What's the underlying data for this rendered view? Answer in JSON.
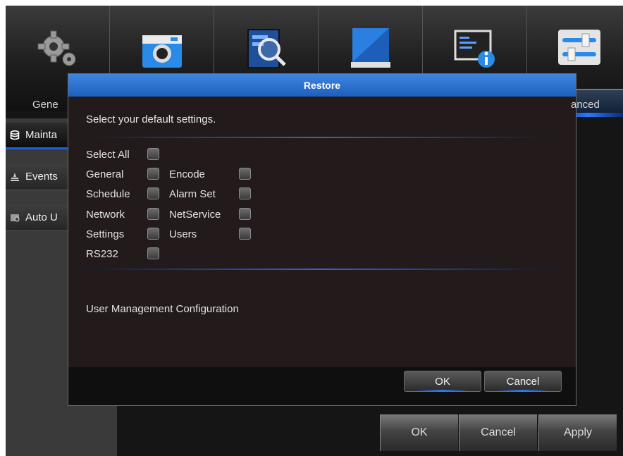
{
  "topbar": {
    "items": [
      {
        "label": "Gene",
        "icon": "gear-icon"
      },
      {
        "label": "",
        "icon": "camera-icon"
      },
      {
        "label": "",
        "icon": "search-icon"
      },
      {
        "label": "",
        "icon": "storage-icon"
      },
      {
        "label": "",
        "icon": "info-icon"
      },
      {
        "label": "anced",
        "icon": "sliders-icon"
      }
    ]
  },
  "sidebar": {
    "items": [
      {
        "label": "Mainta",
        "icon": "database-icon",
        "active": true
      },
      {
        "label": "Events",
        "icon": "events-icon",
        "active": false
      },
      {
        "label": "Auto U",
        "icon": "auto-upgrade-icon",
        "active": false
      }
    ]
  },
  "main_buttons": {
    "ok": "OK",
    "cancel": "Cancel",
    "apply": "Apply"
  },
  "dialog": {
    "title": "Restore",
    "prompt": "Select your default settings.",
    "select_all": "Select All",
    "options": [
      {
        "label": "General",
        "checked": false
      },
      {
        "label": "Encode",
        "checked": false
      },
      {
        "label": "Schedule",
        "checked": false
      },
      {
        "label": "Alarm Set",
        "checked": false
      },
      {
        "label": "Network",
        "checked": false
      },
      {
        "label": "NetService",
        "checked": false
      },
      {
        "label": "Settings",
        "checked": false
      },
      {
        "label": "Users",
        "checked": false
      },
      {
        "label": "RS232",
        "checked": false
      }
    ],
    "info": "User Management Configuration",
    "ok_label": "OK",
    "cancel_label": "Cancel"
  },
  "colors": {
    "accent": "#2a78ff",
    "title_bar": "#2e72d2",
    "background": "#151515"
  }
}
